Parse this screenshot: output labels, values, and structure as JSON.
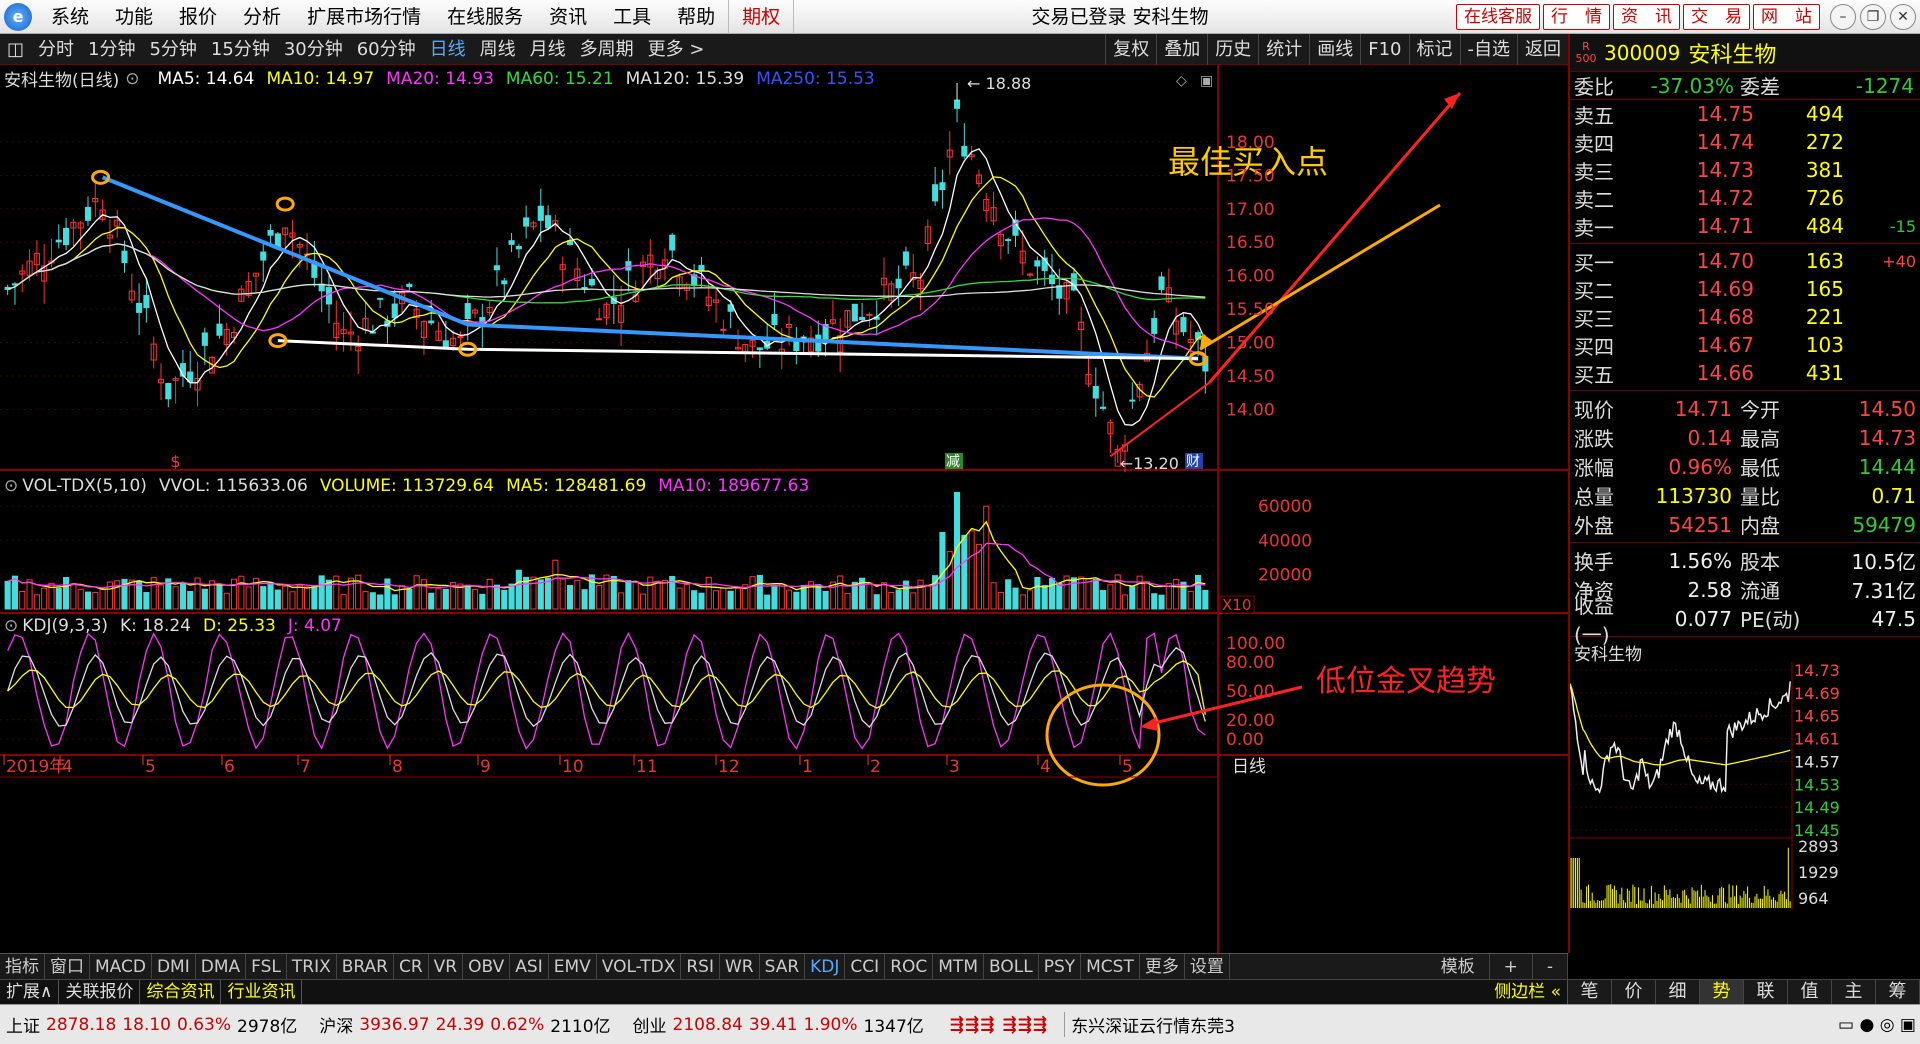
{
  "menu": {
    "logo": "e",
    "items": [
      "系统",
      "功能",
      "报价",
      "分析",
      "扩展市场行情",
      "在线服务",
      "资讯",
      "工具",
      "帮助"
    ],
    "option": "期权"
  },
  "window": {
    "title": "交易已登录  安科生物"
  },
  "quick_buttons": [
    "在线客服",
    "行　情",
    "资　讯",
    "交　易",
    "网　站"
  ],
  "toolbar": {
    "left": [
      "分时",
      "1分钟",
      "5分钟",
      "15分钟",
      "30分钟",
      "60分钟",
      "日线",
      "周线",
      "月线",
      "多周期",
      "更多 >"
    ],
    "active": "日线",
    "right": [
      "复权",
      "叠加",
      "历史",
      "统计",
      "画线",
      "F10",
      "标记",
      "-自选",
      "返回"
    ]
  },
  "main_legend": {
    "name": "安科生物(日线)",
    "items": [
      {
        "t": "MA5: 14.64",
        "c": "#ffffff"
      },
      {
        "t": "MA10: 14.97",
        "c": "#ffff00"
      },
      {
        "t": "MA20: 14.93",
        "c": "#ff33ff"
      },
      {
        "t": "MA60: 15.21",
        "c": "#33dd33"
      },
      {
        "t": "MA120: 15.39",
        "c": "#dddddd"
      },
      {
        "t": "MA250: 15.53",
        "c": "#3355ff"
      }
    ]
  },
  "vol_legend": {
    "name": "VOL-TDX(5,10)",
    "items": [
      {
        "t": "VVOL: 115633.06",
        "c": "#dddddd"
      },
      {
        "t": "VOLUME: 113729.64",
        "c": "#ffff00"
      },
      {
        "t": "MA5: 128481.69",
        "c": "#ffff00"
      },
      {
        "t": "MA10: 189677.63",
        "c": "#ff33ff"
      }
    ]
  },
  "kdj_legend": {
    "name": "KDJ(9,3,3)",
    "items": [
      {
        "t": "K: 18.24",
        "c": "#dddddd"
      },
      {
        "t": "D: 25.33",
        "c": "#ffff00"
      },
      {
        "t": "J: 4.07",
        "c": "#ff33ff"
      }
    ]
  },
  "price_axis": [
    "18.00",
    "17.50",
    "17.00",
    "16.50",
    "16.00",
    "15.50",
    "15.00",
    "14.50",
    "14.00"
  ],
  "vol_axis": [
    "60000",
    "40000",
    "20000"
  ],
  "vol_unit": "X10",
  "kdj_axis": [
    "100.00",
    "80.00",
    "50.00",
    "20.00",
    "0.00"
  ],
  "months": [
    "2019年",
    "4",
    "5",
    "6",
    "7",
    "8",
    "9",
    "10",
    "11",
    "12",
    "1",
    "2",
    "3",
    "4",
    "5"
  ],
  "period_label": "日线",
  "marks": {
    "high": "18.88",
    "low": "13.20",
    "dividend": "$",
    "reduce": "减",
    "finance": "财"
  },
  "annotations": {
    "best_buy": "最佳买入点",
    "golden_cross": "低位金叉趋势"
  },
  "chart_data": {
    "type": "candlestick",
    "price_range": [
      13.2,
      18.88
    ],
    "trendlines": [
      {
        "color": "#3399ff",
        "points": [
          [
            13,
            17.47
          ],
          [
            63,
            15.27
          ],
          [
            163,
            14.76
          ]
        ]
      },
      {
        "color": "#ffffff",
        "points": [
          [
            37,
            15.03
          ],
          [
            63,
            14.9
          ],
          [
            163,
            14.76
          ]
        ]
      }
    ],
    "ma_values": {
      "MA5": 14.64,
      "MA10": 14.97,
      "MA20": 14.93,
      "MA60": 15.21,
      "MA120": 15.39,
      "MA250": 15.53
    },
    "kdj": {
      "K": 18.24,
      "D": 25.33,
      "J": 4.07
    }
  },
  "right_panel": {
    "code": "300009",
    "name": "安科生物",
    "market_tag": "R 500",
    "webi": {
      "label1": "委比",
      "v1": "-37.03%",
      "label2": "委差",
      "v2": "-1274"
    },
    "sell": [
      {
        "l": "卖五",
        "p": "14.75",
        "v": "494",
        "c": ""
      },
      {
        "l": "卖四",
        "p": "14.74",
        "v": "272",
        "c": ""
      },
      {
        "l": "卖三",
        "p": "14.73",
        "v": "381",
        "c": ""
      },
      {
        "l": "卖二",
        "p": "14.72",
        "v": "726",
        "c": ""
      },
      {
        "l": "卖一",
        "p": "14.71",
        "v": "484",
        "c": "-15"
      }
    ],
    "buy": [
      {
        "l": "买一",
        "p": "14.70",
        "v": "163",
        "c": "+40"
      },
      {
        "l": "买二",
        "p": "14.69",
        "v": "165",
        "c": ""
      },
      {
        "l": "买三",
        "p": "14.68",
        "v": "221",
        "c": ""
      },
      {
        "l": "买四",
        "p": "14.67",
        "v": "103",
        "c": ""
      },
      {
        "l": "买五",
        "p": "14.66",
        "v": "431",
        "c": ""
      }
    ],
    "quotes": [
      {
        "l1": "现价",
        "v1": "14.71",
        "c1": "red",
        "l2": "今开",
        "v2": "14.50",
        "c2": "red"
      },
      {
        "l1": "涨跌",
        "v1": "0.14",
        "c1": "red",
        "l2": "最高",
        "v2": "14.73",
        "c2": "red"
      },
      {
        "l1": "涨幅",
        "v1": "0.96%",
        "c1": "red",
        "l2": "最低",
        "v2": "14.44",
        "c2": "grn"
      },
      {
        "l1": "总量",
        "v1": "113730",
        "c1": "yel",
        "l2": "量比",
        "v2": "0.71",
        "c2": "yel"
      },
      {
        "l1": "外盘",
        "v1": "54251",
        "c1": "red",
        "l2": "内盘",
        "v2": "59479",
        "c2": "grn"
      }
    ],
    "fin": [
      {
        "l1": "换手",
        "v1": "1.56%",
        "l2": "股本",
        "v2": "10.5亿"
      },
      {
        "l1": "净资",
        "v1": "2.58",
        "l2": "流通",
        "v2": "7.31亿"
      },
      {
        "l1": "收益(一)",
        "v1": "0.077",
        "l2": "PE(动)",
        "v2": "47.5"
      }
    ],
    "mini_title": "安科生物",
    "mini_axis": [
      "14.73",
      "14.69",
      "14.65",
      "14.61",
      "14.57",
      "14.53",
      "14.49",
      "14.45"
    ],
    "mini_vol_axis": [
      "2893",
      "1929",
      "964"
    ]
  },
  "indicators": [
    "指标",
    "窗口",
    "MACD",
    "DMI",
    "DMA",
    "FSL",
    "TRIX",
    "BRAR",
    "CR",
    "VR",
    "OBV",
    "ASI",
    "EMV",
    "VOL-TDX",
    "RSI",
    "WR",
    "SAR",
    "KDJ",
    "CCI",
    "ROC",
    "MTM",
    "BOLL",
    "PSY",
    "MCST",
    "更多",
    "设置"
  ],
  "indicator_active": "KDJ",
  "indicator_right": [
    "模板",
    "+",
    "-"
  ],
  "ext_tabs": [
    "扩展∧",
    "关联报价",
    "综合资讯",
    "行业资讯"
  ],
  "ext_right": "侧边栏 «",
  "rp_tabs": [
    "笔",
    "价",
    "细",
    "势",
    "联",
    "值",
    "主",
    "筹"
  ],
  "rp_tab_active": "势",
  "status": {
    "sh": {
      "n": "上证",
      "p": "2878.18",
      "c": "18.10",
      "pct": "0.63%",
      "amt": "2978亿"
    },
    "sz": {
      "n": "沪深",
      "p": "3936.97",
      "c": "24.39",
      "pct": "0.62%",
      "amt": "2110亿"
    },
    "cy": {
      "n": "创业",
      "p": "2108.84",
      "c": "39.41",
      "pct": "1.90%",
      "amt": "1347亿"
    },
    "server": "东兴深证云行情东莞3"
  }
}
